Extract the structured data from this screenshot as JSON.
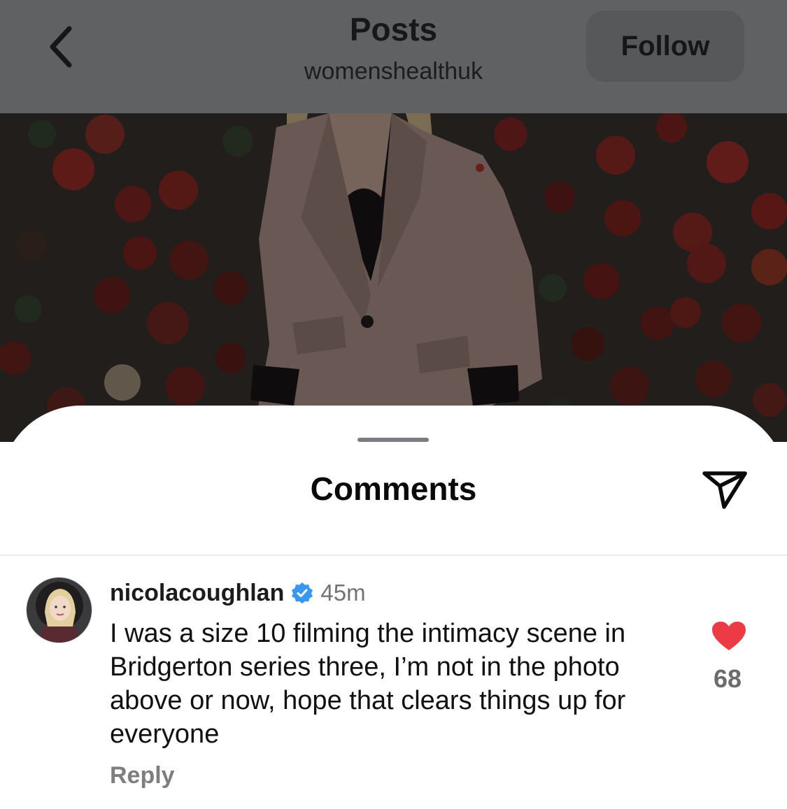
{
  "header": {
    "title": "Posts",
    "subtitle": "womenshealthuk",
    "follow_label": "Follow",
    "back_icon": "chevron-left-icon"
  },
  "photo": {
    "description_icon": "post-photo"
  },
  "comments_sheet": {
    "title": "Comments",
    "share_icon": "paper-plane-icon"
  },
  "comments": [
    {
      "username": "nicolacoughlan",
      "verified": true,
      "time": "45m",
      "text": "I was a size 10 filming the intimacy scene in Bridgerton series three, I’m not in the photo above or now, hope that clears things up for everyone",
      "reply_label": "Reply",
      "likes": "68",
      "liked": true
    }
  ],
  "colors": {
    "like_red": "#ed3b45",
    "verified_blue": "#3897f0",
    "overlay_gray": "#5f6163"
  }
}
